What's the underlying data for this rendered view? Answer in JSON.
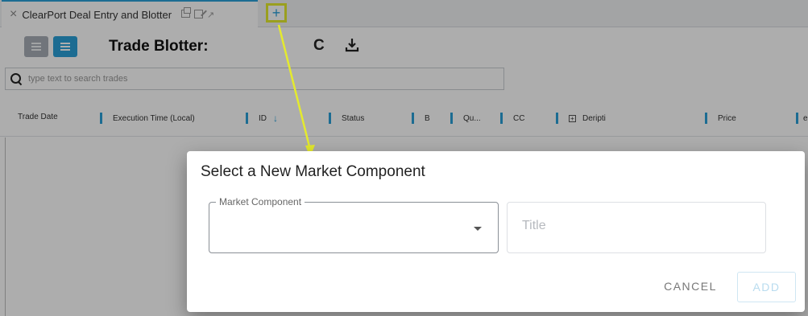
{
  "tab": {
    "title": "ClearPort Deal Entry and Blotter",
    "close_glyph": "×",
    "add_glyph": "+"
  },
  "toolbar": {
    "title": "Trade Blotter:",
    "refresh_glyph": "C"
  },
  "search": {
    "placeholder": "type text to search trades",
    "value": ""
  },
  "grid": {
    "columns": [
      {
        "label": "Trade Date"
      },
      {
        "label": "Execution Time (Local)"
      },
      {
        "label": "ID"
      },
      {
        "label": "Status"
      },
      {
        "label": "B"
      },
      {
        "label": "Qu..."
      },
      {
        "label": "CC"
      },
      {
        "label": "Deripti"
      },
      {
        "label": "Price"
      },
      {
        "label": "en"
      }
    ],
    "sort_arrow": "↓"
  },
  "dialog": {
    "title": "Select a New Market Component",
    "market_component_label": "Market Component",
    "market_component_value": "",
    "title_placeholder": "Title",
    "title_value": "",
    "cancel_label": "CANCEL",
    "add_label": "ADD"
  },
  "colors": {
    "accent": "#2a9fd8",
    "annotation": "#e4ea2e"
  }
}
